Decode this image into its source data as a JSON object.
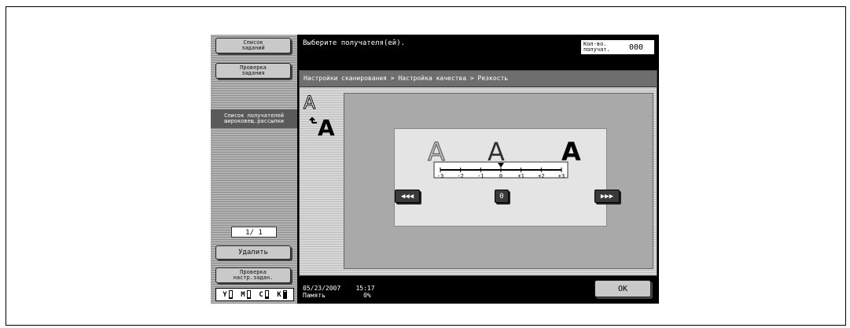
{
  "sidebar": {
    "job_list": [
      "Список",
      "заданий"
    ],
    "job_check": [
      "Проверка",
      "задания"
    ],
    "broadcast_label": [
      "Список получателей",
      "широковещ.рассылки"
    ],
    "page": "1/  1",
    "delete": "Удалить",
    "check_settings": [
      "Проверка",
      "настр.задан."
    ],
    "toner": [
      {
        "letter": "Y",
        "level": 0.1
      },
      {
        "letter": "M",
        "level": 0.1
      },
      {
        "letter": "C",
        "level": 0.2
      },
      {
        "letter": "K",
        "level": 0.9
      }
    ]
  },
  "header": {
    "message": "Выберите получателя(ей).",
    "recipients_label": [
      "Кол-во.",
      "получат."
    ],
    "recipients_value": "000"
  },
  "breadcrumb": "Настройки сканирования > Настройка качества > Резкость",
  "sharpness": {
    "letters": [
      "A",
      "A",
      "A"
    ],
    "ticks": [
      "-3",
      "-2",
      "-1",
      "0",
      "+1",
      "+2",
      "+3"
    ],
    "current_value": 0,
    "left_button": "◀◀◀",
    "center_button": "0",
    "right_button": "▶▶▶"
  },
  "footer": {
    "date": "05/23/2007",
    "time": "15:17",
    "memory_label": "Память",
    "memory_value": "0%",
    "ok": "OK"
  }
}
